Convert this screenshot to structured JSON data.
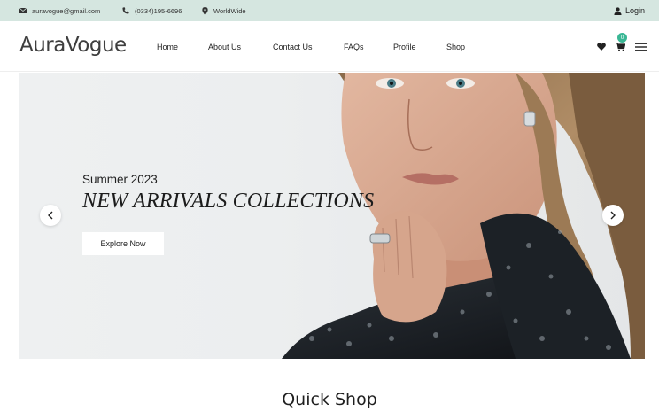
{
  "topbar": {
    "email": "auravogue@gmail.com",
    "phone": "(0334)195-6696",
    "location": "WorldWide",
    "login_label": "Login"
  },
  "header": {
    "logo": "AuraVogue",
    "nav": [
      "Home",
      "About Us",
      "Contact Us",
      "FAQs",
      "Profile",
      "Shop"
    ],
    "cart_count": "0"
  },
  "hero": {
    "subtitle": "Summer 2023",
    "title": "NEW ARRIVALS COLLECTIONS",
    "button_label": "Explore Now"
  },
  "quick_shop": {
    "title": "Quick Shop"
  },
  "colors": {
    "topbar_bg": "#d5e6e0",
    "badge": "#3ab795",
    "text": "#222222"
  },
  "icons": [
    "envelope-icon",
    "phone-icon",
    "location-pin-icon",
    "user-icon",
    "heart-icon",
    "cart-icon",
    "menu-icon",
    "chevron-left-icon",
    "chevron-right-icon"
  ]
}
